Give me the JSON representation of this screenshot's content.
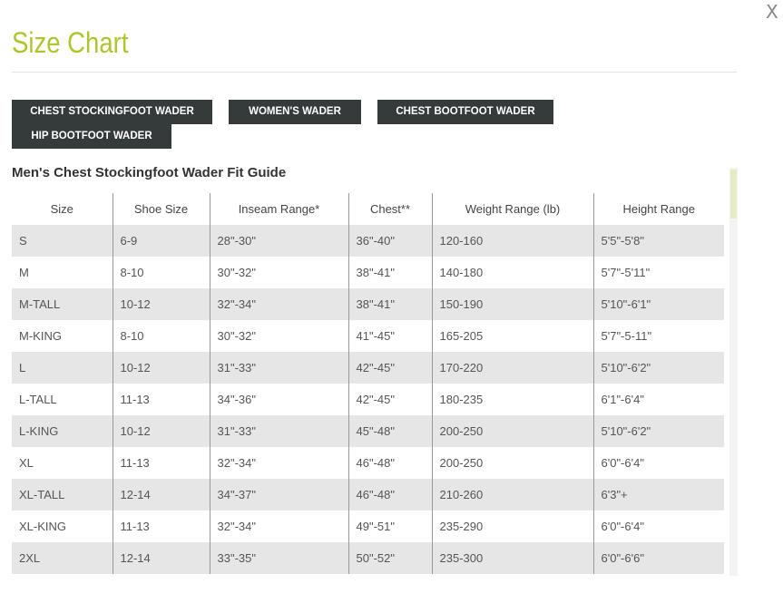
{
  "close_label": "X",
  "title": "Size Chart",
  "tabs": [
    {
      "label": "CHEST STOCKINGFOOT WADER"
    },
    {
      "label": "WOMEN'S WADER"
    },
    {
      "label": "CHEST BOOTFOOT WADER"
    },
    {
      "label": "HIP BOOTFOOT WADER"
    }
  ],
  "subtitle": "Men's Chest Stockingfoot Wader Fit Guide",
  "table": {
    "headers": [
      "Size",
      "Shoe Size",
      "Inseam Range*",
      "Chest**",
      "Weight Range (lb)",
      "Height Range"
    ],
    "rows": [
      [
        "S",
        "6-9",
        "28\"-30\"",
        "36\"-40\"",
        "120-160",
        "5'5\"-5'8\""
      ],
      [
        "M",
        "8-10",
        "30\"-32\"",
        "38\"-41\"",
        "140-180",
        "5'7\"-5'11\""
      ],
      [
        "M-TALL",
        "10-12",
        "32\"-34\"",
        "38\"-41\"",
        "150-190",
        "5'10\"-6'1\""
      ],
      [
        "M-KING",
        "8-10",
        "30\"-32\"",
        "41\"-45\"",
        "165-205",
        "5'7\"-5-11\""
      ],
      [
        "L",
        "10-12",
        "31\"-33\"",
        "42\"-45\"",
        "170-220",
        "5'10\"-6'2\""
      ],
      [
        "L-TALL",
        "11-13",
        "34\"-36\"",
        "42\"-45\"",
        "180-235",
        "6'1\"-6'4\""
      ],
      [
        "L-KING",
        "10-12",
        "31\"-33\"",
        "45\"-48\"",
        "200-250",
        "5'10\"-6'2\""
      ],
      [
        "XL",
        "11-13",
        "32\"-34\"",
        "46\"-48\"",
        "200-250",
        "6'0\"-6'4\""
      ],
      [
        "XL-TALL",
        "12-14",
        "34\"-37\"",
        "46\"-48\"",
        "210-260",
        "6'3\"+"
      ],
      [
        "XL-KING",
        "11-13",
        "32\"-34\"",
        "49\"-51\"",
        "235-290",
        "6'0\"-6'4\""
      ],
      [
        "2XL",
        "12-14",
        "33\"-35\"",
        "50\"-52\"",
        "235-300",
        "6'0\"-6'6\""
      ]
    ]
  },
  "colors": {
    "title": "#b1c42c",
    "tab_bg": "#353b3b",
    "row_stripe": "#e6e6e6"
  }
}
